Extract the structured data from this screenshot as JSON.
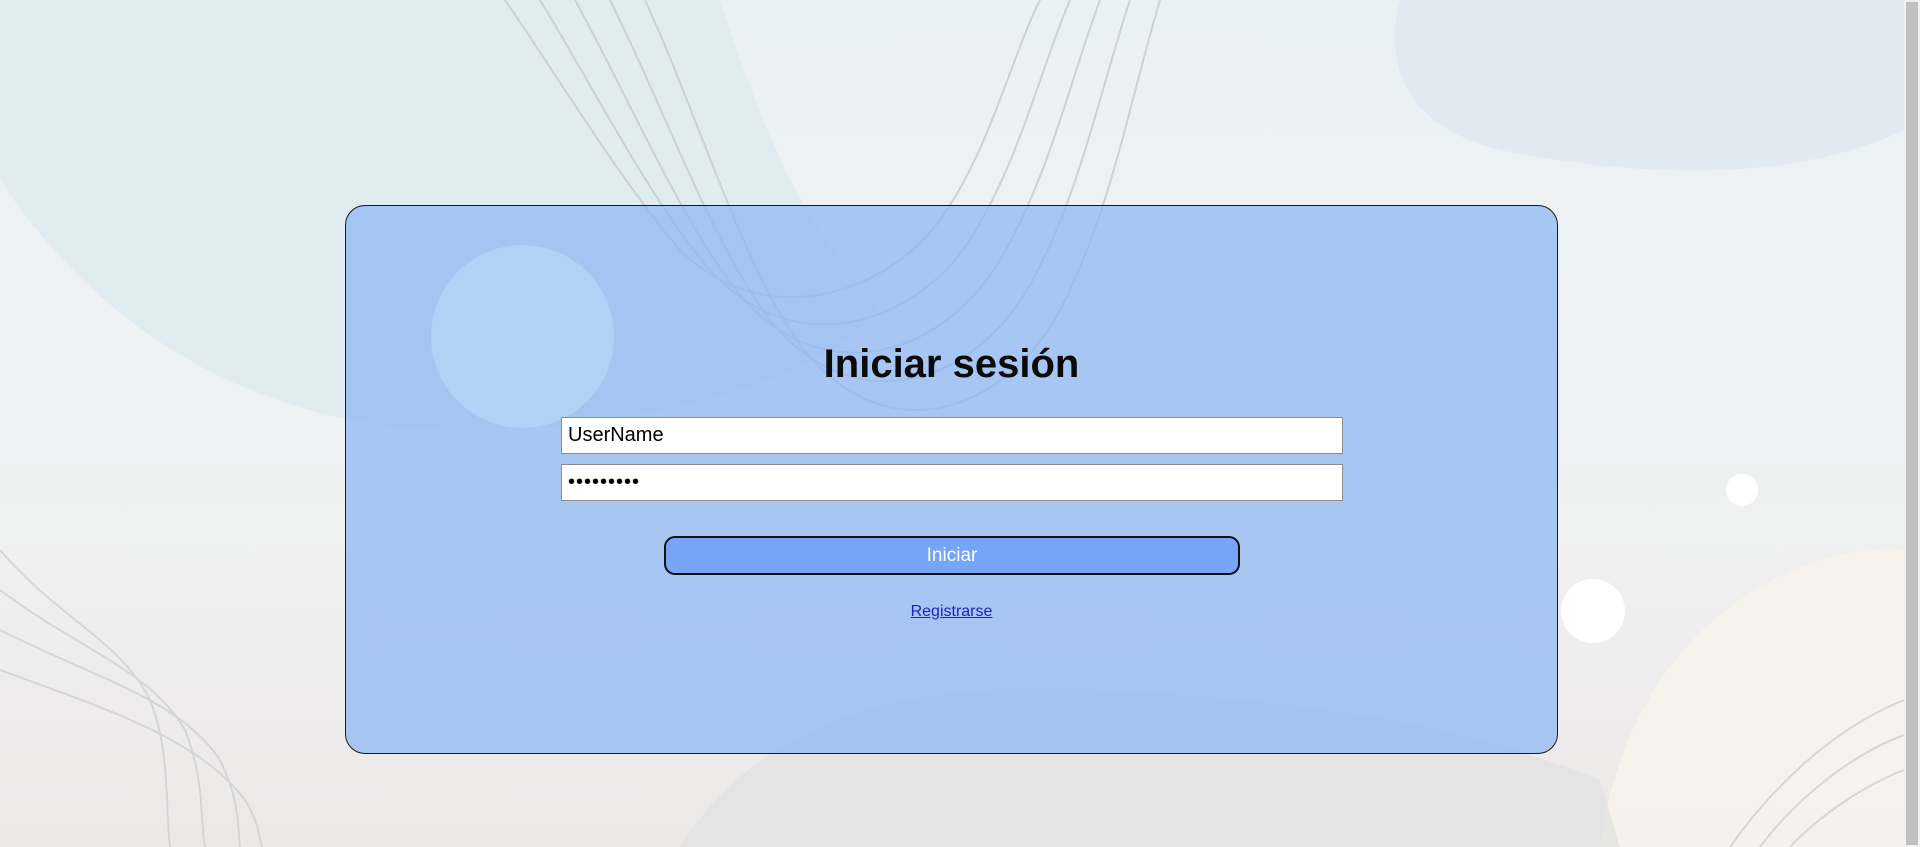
{
  "login": {
    "title": "Iniciar sesión",
    "username_value": "UserName",
    "password_value": "•••••••••",
    "submit_label": "Iniciar",
    "register_label": "Registrarse"
  },
  "colors": {
    "card_fill": "#8cb6f2",
    "button_fill": "#76a4f6",
    "link": "#1b23c8"
  },
  "icons": {
    "background": "decorative-waves"
  }
}
